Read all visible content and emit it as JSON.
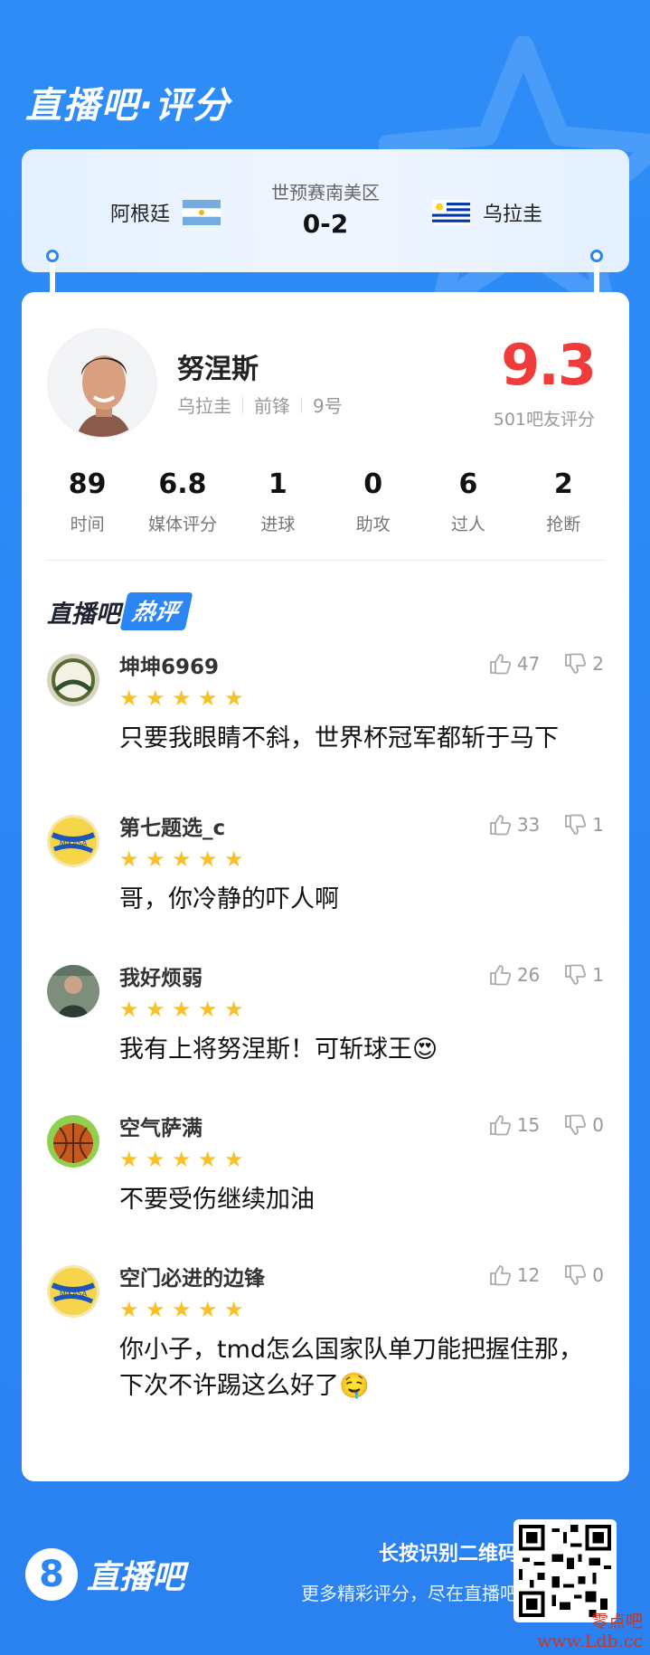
{
  "app_title": "直播吧·评分",
  "match": {
    "home": "阿根廷",
    "away": "乌拉圭",
    "competition": "世预赛南美区",
    "score": "0-2"
  },
  "player": {
    "name": "努涅斯",
    "team": "乌拉圭",
    "position": "前锋",
    "number": "9号",
    "rating": "9.3",
    "rating_sub": "501吧友评分"
  },
  "stats": [
    {
      "value": "89",
      "label": "时间"
    },
    {
      "value": "6.8",
      "label": "媒体评分"
    },
    {
      "value": "1",
      "label": "进球"
    },
    {
      "value": "0",
      "label": "助攻"
    },
    {
      "value": "6",
      "label": "过人"
    },
    {
      "value": "2",
      "label": "抢断"
    }
  ],
  "hot": {
    "a": "直播吧",
    "b": "热评"
  },
  "comments": [
    {
      "user": "坤坤6969",
      "stars": 5,
      "text": "只要我眼睛不斜，世界杯冠军都斩于马下",
      "likes": "47",
      "dislikes": "2"
    },
    {
      "user": "第七题选_c",
      "stars": 5,
      "text": "哥，你冷静的吓人啊",
      "likes": "33",
      "dislikes": "1"
    },
    {
      "user": "我好烦弱",
      "stars": 5,
      "text": "我有上将努涅斯！可斩球王😍",
      "likes": "26",
      "dislikes": "1"
    },
    {
      "user": "空气萨满",
      "stars": 5,
      "text": "不要受伤继续加油",
      "likes": "15",
      "dislikes": "0"
    },
    {
      "user": "空门必进的边锋",
      "stars": 5,
      "text": "你小子，tmd怎么国家队单刀能把握住那，下次不许踢这么好了🤤",
      "likes": "12",
      "dislikes": "0"
    }
  ],
  "footer": {
    "logo_mark": "8",
    "logo_text": "直播吧",
    "cta_main": "长按识别二维码",
    "cta_sub": "更多精彩评分，尽在直播吧"
  },
  "watermark": {
    "line1": "零点吧",
    "line2": "www.Ldb.cc"
  },
  "colors": {
    "accent": "#2b86f3",
    "rating": "#ef3b3a",
    "star": "#f7c12a"
  }
}
